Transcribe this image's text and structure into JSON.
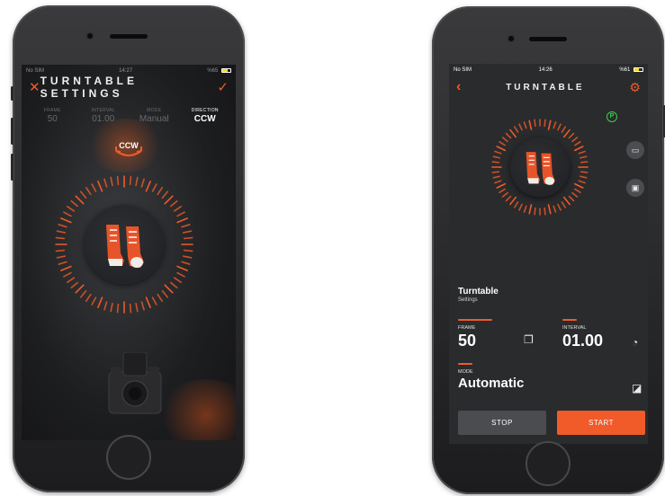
{
  "phone1": {
    "status": {
      "carrier": "No SIM",
      "time": "14:27",
      "battery": "%65"
    },
    "header": {
      "title": "TURNTABLE SETTINGS"
    },
    "params": [
      {
        "label": "FRAME",
        "value": "50",
        "active": false
      },
      {
        "label": "INTERVAL",
        "value": "01.00",
        "active": false
      },
      {
        "label": "MODE",
        "value": "Manual",
        "active": false
      },
      {
        "label": "DIRECTION",
        "value": "CCW",
        "active": true
      }
    ],
    "direction_badge": "CCW"
  },
  "phone2": {
    "status": {
      "carrier": "No SIM",
      "time": "14:26",
      "battery": "%61"
    },
    "header": {
      "title": "TURNTABLE"
    },
    "badge": "P",
    "section": {
      "title": "Turntable",
      "subtitle": "Settings"
    },
    "frame": {
      "label": "FRAME",
      "value": "50"
    },
    "interval": {
      "label": "INTERVAL",
      "value": "01.00"
    },
    "mode": {
      "label": "MODE",
      "value": "Automatic"
    },
    "buttons": {
      "stop": "STOP",
      "start": "START"
    }
  },
  "colors": {
    "accent": "#f15a29",
    "screen_bg": "#2a2b2d",
    "badge_green": "#3ccf4e"
  }
}
